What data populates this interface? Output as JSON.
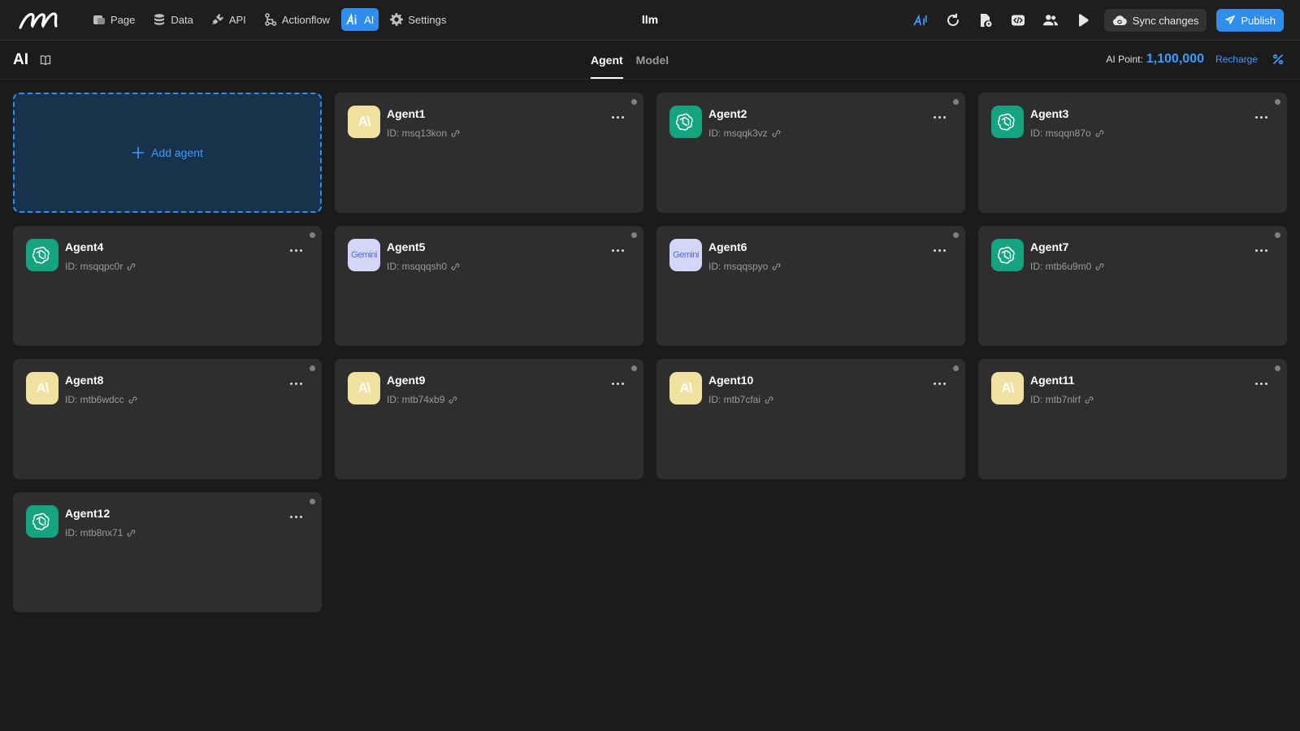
{
  "topbar": {
    "project_name": "llm",
    "nav": [
      {
        "label": "Page",
        "icon": "page-icon"
      },
      {
        "label": "Data",
        "icon": "database-icon"
      },
      {
        "label": "API",
        "icon": "plug-icon"
      },
      {
        "label": "Actionflow",
        "icon": "flow-icon"
      },
      {
        "label": "AI",
        "icon": "ai-icon",
        "active": true
      },
      {
        "label": "Settings",
        "icon": "gear-icon"
      }
    ],
    "sync_label": "Sync changes",
    "publish_label": "Publish",
    "accent_color": "#2f8df0"
  },
  "subheader": {
    "title": "AI",
    "tabs": [
      {
        "label": "Agent",
        "active": true
      },
      {
        "label": "Model",
        "active": false
      }
    ],
    "ai_point_label": "AI Point:",
    "ai_point_value": "1,100,000",
    "recharge_label": "Recharge"
  },
  "add_agent_label": "Add agent",
  "agents": [
    {
      "name": "Agent1",
      "id": "ID: msq13kon",
      "provider": "anthropic"
    },
    {
      "name": "Agent2",
      "id": "ID: msqqk3vz",
      "provider": "openai"
    },
    {
      "name": "Agent3",
      "id": "ID: msqqn87o",
      "provider": "openai"
    },
    {
      "name": "Agent4",
      "id": "ID: msqqpc0r",
      "provider": "openai"
    },
    {
      "name": "Agent5",
      "id": "ID: msqqqsh0",
      "provider": "gemini"
    },
    {
      "name": "Agent6",
      "id": "ID: msqqspyo",
      "provider": "gemini"
    },
    {
      "name": "Agent7",
      "id": "ID: mtb6u9m0",
      "provider": "openai"
    },
    {
      "name": "Agent8",
      "id": "ID: mtb6wdcc",
      "provider": "anthropic"
    },
    {
      "name": "Agent9",
      "id": "ID: mtb74xb9",
      "provider": "anthropic"
    },
    {
      "name": "Agent10",
      "id": "ID: mtb7cfai",
      "provider": "anthropic"
    },
    {
      "name": "Agent11",
      "id": "ID: mtb7nlrf",
      "provider": "anthropic"
    },
    {
      "name": "Agent12",
      "id": "ID: mtb8nx71",
      "provider": "openai"
    }
  ],
  "provider_marks": {
    "anthropic": "A\\",
    "gemini": "Gemini"
  }
}
